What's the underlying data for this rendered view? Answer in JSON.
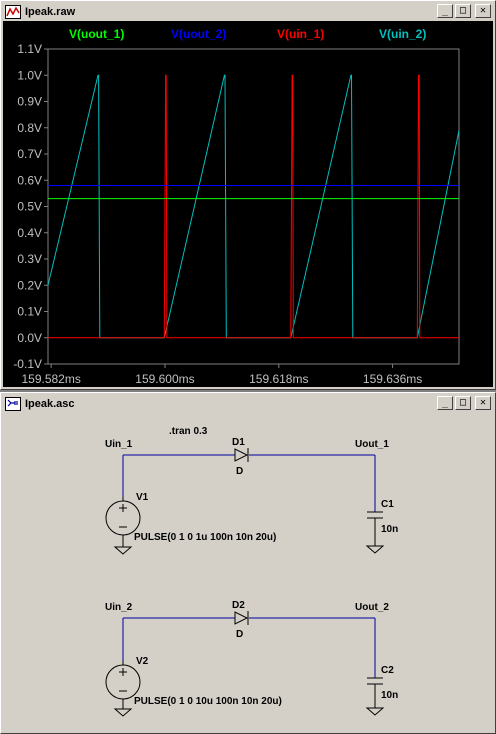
{
  "plot_window": {
    "title": "Ipeak.raw",
    "buttons": {
      "minimize": "_",
      "maximize": "□",
      "close": "✕"
    },
    "traces": [
      {
        "label": "V(uout_1)",
        "color": "#00ff00"
      },
      {
        "label": "V(uout_2)",
        "color": "#0000ff"
      },
      {
        "label": "V(uin_1)",
        "color": "#ff0000"
      },
      {
        "label": "V(uin_2)",
        "color": "#00c0c0"
      }
    ],
    "y_ticks": [
      "1.1V",
      "1.0V",
      "0.9V",
      "0.8V",
      "0.7V",
      "0.6V",
      "0.5V",
      "0.4V",
      "0.3V",
      "0.2V",
      "0.1V",
      "0.0V",
      "-0.1V"
    ],
    "x_ticks": [
      "159.582ms",
      "159.600ms",
      "159.618ms",
      "159.636ms"
    ]
  },
  "chart_data": {
    "type": "line",
    "x_unit": "ms",
    "y_unit": "V",
    "xlim": [
      159.5815,
      159.6465
    ],
    "ylim": [
      -0.1,
      1.1
    ],
    "grid": false,
    "legend_placement": "top",
    "series": [
      {
        "name": "V(uout_1)",
        "color": "#00ff00",
        "x": [
          159.5815,
          159.6465
        ],
        "y": [
          0.53,
          0.53
        ]
      },
      {
        "name": "V(uout_2)",
        "color": "#0000ff",
        "x": [
          159.5815,
          159.6465
        ],
        "y": [
          0.58,
          0.58
        ]
      },
      {
        "name": "V(uin_1)",
        "color": "#ff0000",
        "x": [
          159.5815,
          159.5999,
          159.6001,
          159.6002,
          159.6003,
          159.6199,
          159.6201,
          159.6202,
          159.6203,
          159.6399,
          159.6401,
          159.6402,
          159.6403,
          159.6465
        ],
        "y": [
          0,
          0,
          1,
          1,
          0,
          0,
          1,
          1,
          0,
          0,
          1,
          1,
          0,
          0
        ]
      },
      {
        "name": "V(uin_2)",
        "color": "#00c0c0",
        "x": [
          159.5815,
          159.5894,
          159.5895,
          159.5897,
          159.5999,
          159.6094,
          159.6095,
          159.6097,
          159.6199,
          159.6294,
          159.6295,
          159.6297,
          159.6399,
          159.6465
        ],
        "y": [
          0.2,
          1.0,
          1.0,
          0,
          0,
          1.0,
          1.0,
          0,
          0,
          1.0,
          1.0,
          0,
          0,
          0.79
        ]
      }
    ]
  },
  "schematic_window": {
    "title": "Ipeak.asc",
    "buttons": {
      "minimize": "_",
      "maximize": "□",
      "close": "✕"
    },
    "directive": ".tran 0.3",
    "circuit1": {
      "in_net": "Uin_1",
      "out_net": "Uout_1",
      "diode_name": "D1",
      "diode_value": "D",
      "source_name": "V1",
      "source_value": "PULSE(0 1 0 1u 100n 10n 20u)",
      "cap_name": "C1",
      "cap_value": "10n"
    },
    "circuit2": {
      "in_net": "Uin_2",
      "out_net": "Uout_2",
      "diode_name": "D2",
      "diode_value": "D",
      "source_name": "V2",
      "source_value": "PULSE(0 1 0 10u 100n 10n 20u)",
      "cap_name": "C2",
      "cap_value": "10n"
    }
  }
}
